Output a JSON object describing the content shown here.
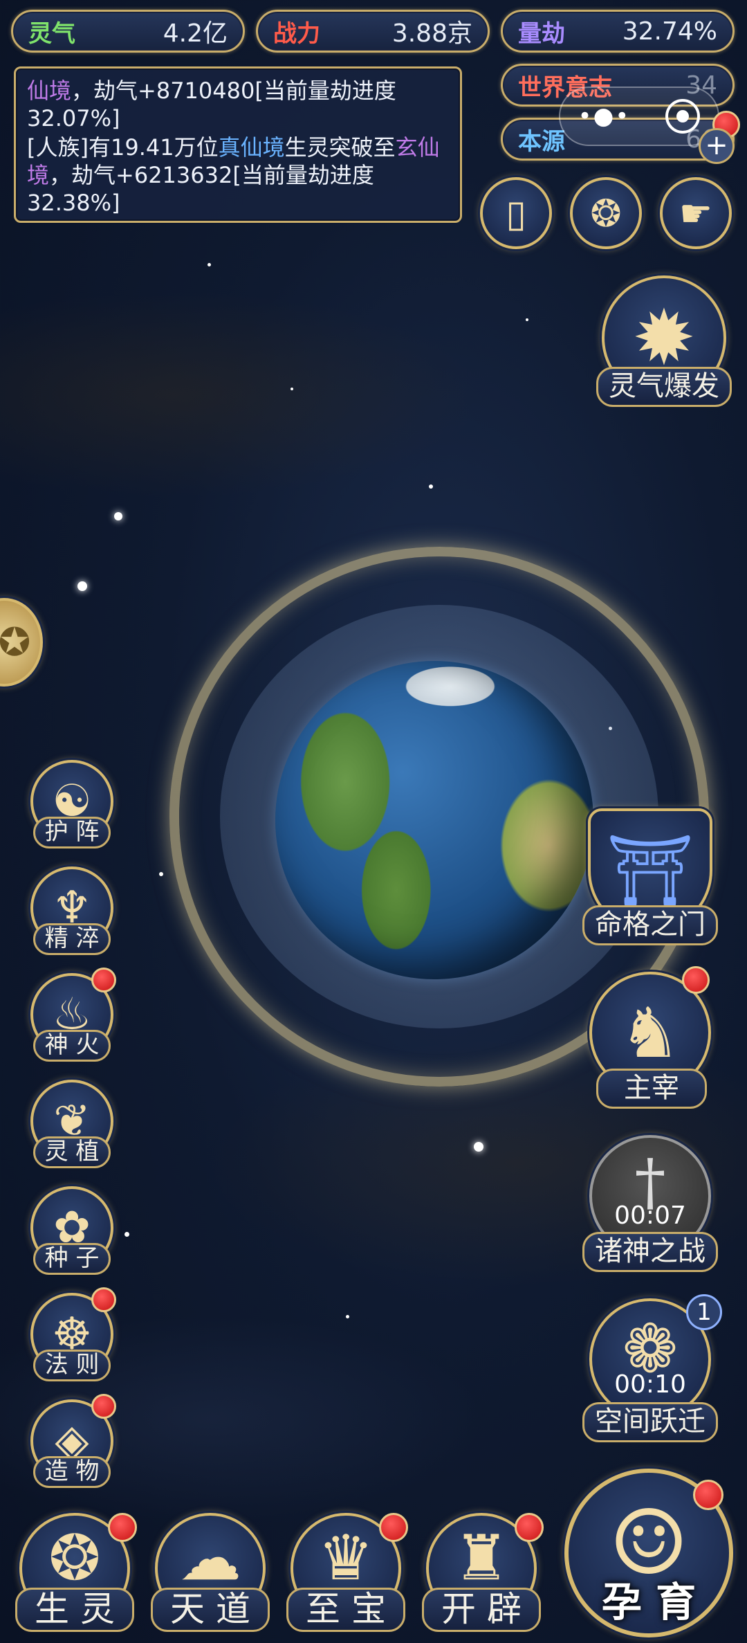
{
  "stats": {
    "lingqi": {
      "label": "灵气",
      "value": "4.2亿",
      "color": "#7fe36b"
    },
    "zhanli": {
      "label": "战力",
      "value": "3.88京",
      "color": "#ff5b4a"
    },
    "liangjie": {
      "label": "量劫",
      "value": "32.74%",
      "color": "#a98cff"
    },
    "shijie": {
      "label": "世界意志",
      "value": "34",
      "color": "#ff6e5c"
    },
    "benyuan": {
      "label": "本源",
      "value": "66",
      "color": "#6fc4ff"
    }
  },
  "log": {
    "line1": {
      "realm": "仙境",
      "text": "，劫气+8710480[当前量劫进度32.07%]"
    },
    "line2": {
      "prefix": "[人族]有19.41万位",
      "realm_a": "真仙境",
      "mid": "生灵突破至",
      "realm_b": "玄仙境",
      "suffix": "，劫气+6213632[当前量劫进度32.38%]"
    }
  },
  "top_icons": [
    "card-icon",
    "portal-icon",
    "hand-icon"
  ],
  "right_buttons": [
    {
      "id": "burst",
      "label": "灵气爆发"
    },
    {
      "id": "fate_gate",
      "label": "命格之门"
    },
    {
      "id": "master",
      "label": "主宰"
    },
    {
      "id": "gods_war",
      "label": "诸神之战",
      "timer": "00:07"
    },
    {
      "id": "space_jump",
      "label": "空间跃迁",
      "timer": "00:10",
      "badge": "1"
    }
  ],
  "left_buttons": [
    {
      "id": "formation",
      "label": "护 阵",
      "glyph": "☯"
    },
    {
      "id": "refine",
      "label": "精 淬",
      "glyph": "♆"
    },
    {
      "id": "divine_fire",
      "label": "神 火",
      "glyph": "♨"
    },
    {
      "id": "spirit_plant",
      "label": "灵 植",
      "glyph": "❦"
    },
    {
      "id": "seed",
      "label": "种 子",
      "glyph": "✿"
    },
    {
      "id": "law",
      "label": "法 则",
      "glyph": "☸"
    },
    {
      "id": "creation",
      "label": "造 物",
      "glyph": "◈"
    }
  ],
  "bottom_buttons": [
    {
      "id": "beings",
      "label": "生 灵",
      "glyph": "❂"
    },
    {
      "id": "heaven",
      "label": "天 道",
      "glyph": "☁"
    },
    {
      "id": "treasure",
      "label": "至 宝",
      "glyph": "♛"
    },
    {
      "id": "open",
      "label": "开 辟",
      "glyph": "♜"
    }
  ],
  "gestate": {
    "label": "孕 育",
    "glyph": "☺"
  }
}
